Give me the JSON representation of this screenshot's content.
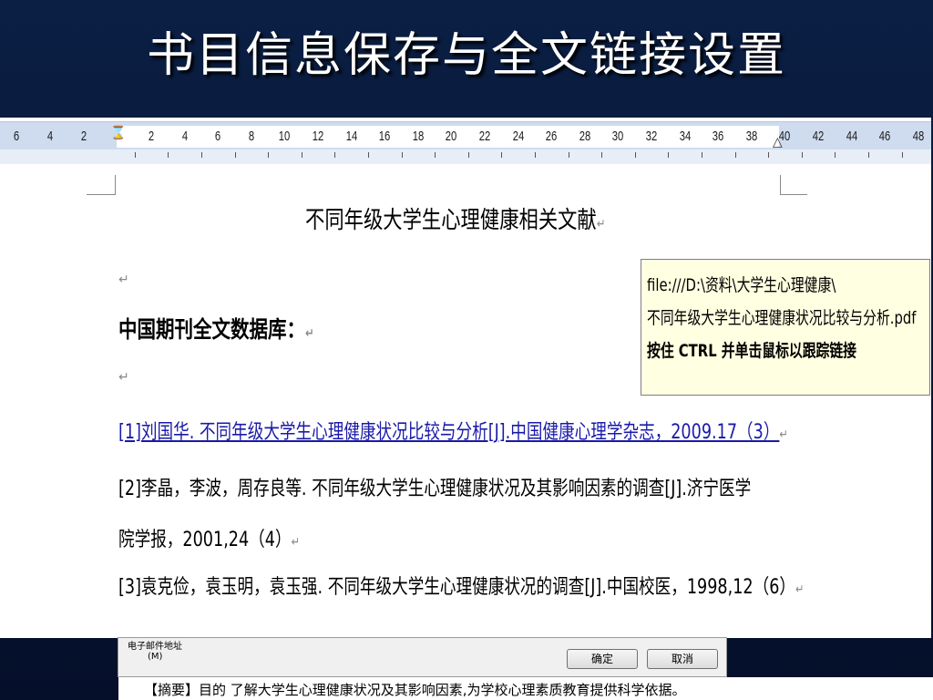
{
  "slide": {
    "title": "书目信息保存与全文链接设置"
  },
  "ruler": {
    "left_numbers": [
      "6",
      "4",
      "2"
    ],
    "right_numbers": [
      "2",
      "4",
      "6",
      "8",
      "10",
      "12",
      "14",
      "16",
      "18",
      "20",
      "22",
      "24",
      "26",
      "28",
      "30",
      "32",
      "34",
      "36",
      "38",
      "40",
      "42",
      "44",
      "46",
      "48"
    ]
  },
  "document": {
    "title": "不同年级大学生心理健康相关文献",
    "section_heading": "中国期刊全文数据库：",
    "para_mark": "↵",
    "references": [
      "[1]刘国华. 不同年级大学生心理健康状况比较与分析[J].中国健康心理学杂志，2009.17（3）",
      "[2]李晶，李波，周存良等. 不同年级大学生心理健康状况及其影响因素的调查[J].济宁医学",
      "院学报，2001,24（4）",
      "[3]袁克俭，袁玉明，袁玉强. 不同年级大学生心理健康状况的调查[J].中国校医，1998,12（6）"
    ]
  },
  "tooltip": {
    "line1": "file:///D:\\资料\\大学生心理健康\\",
    "line2": "不同年级大学生心理健康状况比较与分析.pdf",
    "line3": "按住 CTRL 并单击鼠标以跟踪链接"
  },
  "dialog": {
    "email_label": "电子邮件地址",
    "email_hotkey": "(M)",
    "ok_label": "确定",
    "cancel_label": "取消"
  },
  "abstract": {
    "text": "【摘要】目的   了解大学生心理健康状况及其影响因素,为学校心理素质教育提供科学依据。"
  }
}
